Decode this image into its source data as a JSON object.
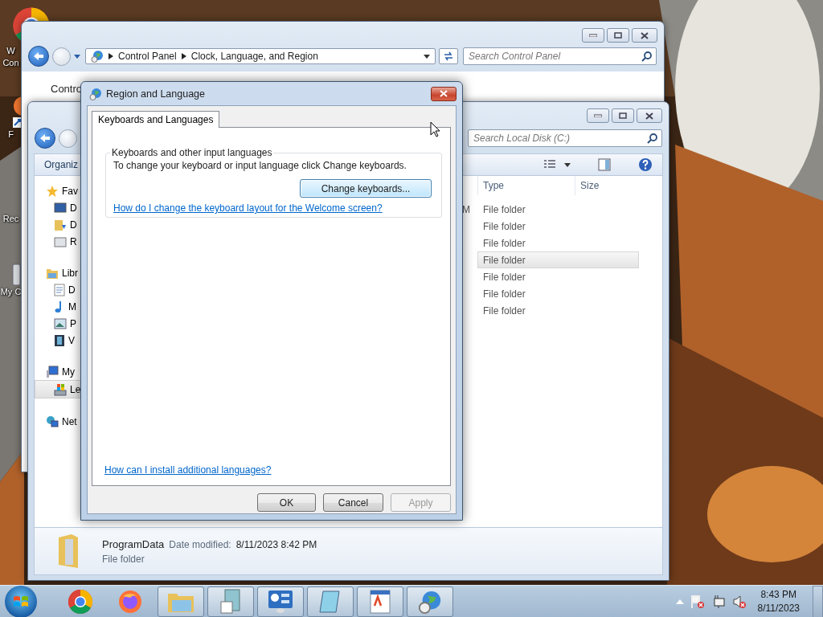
{
  "desktop_icons": [
    {
      "kind": "chrome",
      "lines": [
        "W",
        "Con"
      ]
    },
    {
      "kind": "shortcut",
      "lines": [
        "F"
      ]
    },
    {
      "kind": "bin",
      "lines": [
        "Rec"
      ]
    },
    {
      "kind": "computer",
      "lines": [
        "My C"
      ]
    }
  ],
  "control_panel_window": {
    "address": [
      "Control Panel",
      "Clock, Language, and Region"
    ],
    "search": {
      "placeholder": "Search Control Panel"
    },
    "content_text": "Contro"
  },
  "explorer_window": {
    "search": {
      "placeholder": "Search Local Disk (C:)"
    },
    "toolbar": {
      "organize": "Organiz"
    },
    "sidebar": [
      {
        "label": "Fav",
        "kind": "star",
        "selected": false,
        "children": [
          {
            "label": "D",
            "kind": "desktop",
            "selected": false
          },
          {
            "label": "D",
            "kind": "downloads",
            "selected": false
          },
          {
            "label": "R",
            "kind": "recent",
            "selected": false
          }
        ]
      },
      {
        "label": "Libr",
        "kind": "library",
        "selected": false,
        "children": [
          {
            "label": "D",
            "kind": "document",
            "selected": false
          },
          {
            "label": "M",
            "kind": "music",
            "selected": false
          },
          {
            "label": "P",
            "kind": "pictures",
            "selected": false
          },
          {
            "label": "V",
            "kind": "video",
            "selected": false
          }
        ]
      },
      {
        "label": "My",
        "kind": "computer",
        "selected": false,
        "children": [
          {
            "label": "Le",
            "kind": "disk",
            "selected": true
          }
        ]
      },
      {
        "label": "Net",
        "kind": "network",
        "selected": false
      }
    ],
    "columns": [
      "Type",
      "Size"
    ],
    "rows": [
      {
        "column_1": "M",
        "type": "File folder",
        "selected": false
      },
      {
        "type": "File folder",
        "selected": false
      },
      {
        "type": "File folder",
        "selected": false
      },
      {
        "type": "File folder",
        "selected": true
      },
      {
        "type": "File folder",
        "selected": false
      },
      {
        "type": "File folder",
        "selected": false
      },
      {
        "type": "File folder",
        "selected": false
      }
    ],
    "details": {
      "name": "ProgramData",
      "date_label": "Date modified:",
      "date": "8/11/2023 8:42 PM",
      "type": "File folder"
    }
  },
  "dialog": {
    "title": "Region and Language",
    "tabs": [
      {
        "label": "Keyboards and Languages",
        "selected": true
      }
    ],
    "group": {
      "title": "Keyboards and other input languages",
      "text": "To change your keyboard or input language click Change keyboards.",
      "button": "Change keyboards...",
      "link": "How do I change the keyboard layout for the Welcome screen?"
    },
    "bottom_link": "How can I install additional languages?",
    "buttons": [
      {
        "label": "OK",
        "disabled": false
      },
      {
        "label": "Cancel",
        "disabled": false
      },
      {
        "label": "Apply",
        "disabled": true
      }
    ]
  },
  "taskbar": {
    "items": [
      {
        "kind": "chrome",
        "open": false
      },
      {
        "kind": "firefox",
        "open": false
      },
      {
        "kind": "explorer",
        "open": true
      },
      {
        "kind": "files",
        "open": true
      },
      {
        "kind": "control",
        "open": true
      },
      {
        "kind": "notepad",
        "open": true
      },
      {
        "kind": "wordpad",
        "open": true
      },
      {
        "kind": "region",
        "open": true
      }
    ],
    "tray": [
      {
        "kind": "flag",
        "error": true
      },
      {
        "kind": "network",
        "error": false
      },
      {
        "kind": "speaker",
        "error": true
      }
    ],
    "time": "8:43 PM",
    "date": "8/11/2023"
  }
}
